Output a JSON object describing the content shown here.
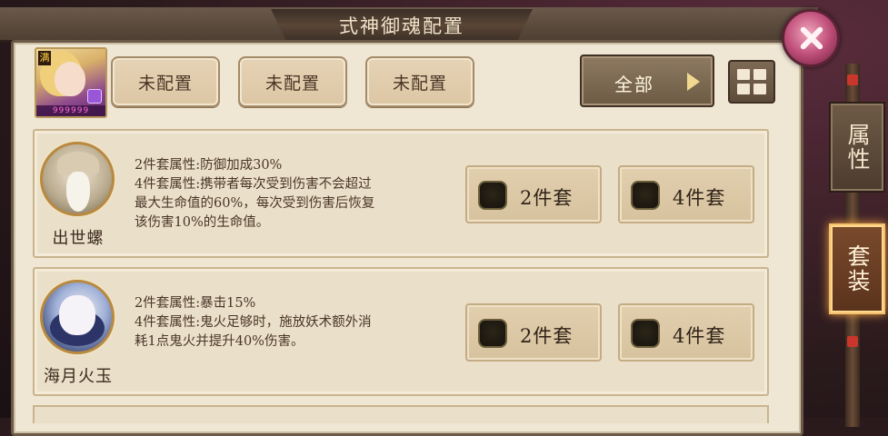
{
  "title": "式神御魂配置",
  "shikigami": {
    "badge": "满",
    "stars": "999999"
  },
  "slots": [
    {
      "label": "未配置"
    },
    {
      "label": "未配置"
    },
    {
      "label": "未配置"
    }
  ],
  "filter": {
    "label": "全部"
  },
  "side_tabs": [
    {
      "label": "属性",
      "active": false
    },
    {
      "label": "套装",
      "active": true
    }
  ],
  "sets": [
    {
      "name": "出世螺",
      "desc": [
        "2件套属性:防御加成30%",
        "4件套属性:携带者每次受到伤害不会超过",
        "最大生命值的60%，每次受到伤害后恢复",
        "该伤害10%的生命值。"
      ],
      "buttons": [
        "2件套",
        "4件套"
      ]
    },
    {
      "name": "海月火玉",
      "desc": [
        "2件套属性:暴击15%",
        "4件套属性:鬼火足够时，施放妖术额外消",
        "耗1点鬼火并提升40%伤害。"
      ],
      "buttons": [
        "2件套",
        "4件套"
      ]
    }
  ]
}
